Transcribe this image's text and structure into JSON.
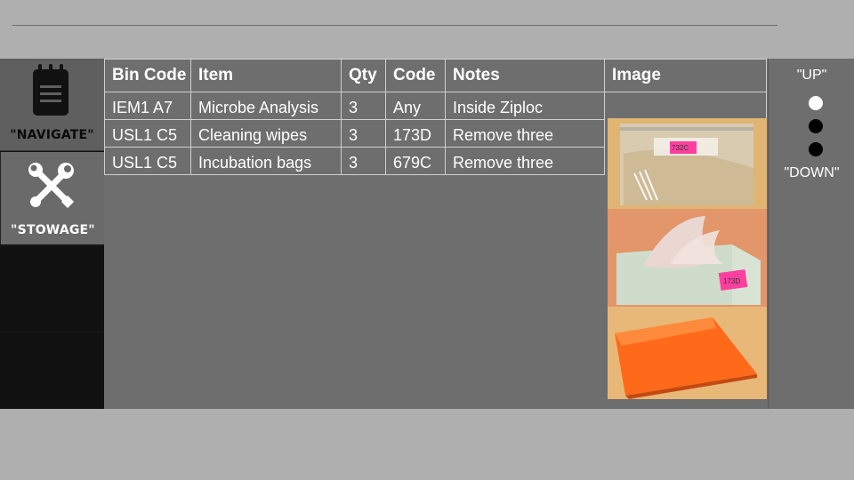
{
  "sidebar": {
    "navigate_label": "\"NAVIGATE\"",
    "stowage_label": "\"STOWAGE\""
  },
  "table": {
    "headers": [
      "Bin Code",
      "Item",
      "Qty",
      "Code",
      "Notes",
      "Image"
    ],
    "rows": [
      [
        "IEM1  A7",
        "Microbe Analysis",
        "3",
        "Any",
        "Inside Ziploc"
      ],
      [
        "USL1  C5",
        "Cleaning wipes",
        "3",
        "173D",
        "Remove three"
      ],
      [
        "USL1  C5",
        "Incubation bags",
        "3",
        "679C",
        "Remove three"
      ]
    ]
  },
  "images": {
    "ziploc_tag": "732C",
    "tissue_tag": "173D"
  },
  "scroll": {
    "up_label": "\"UP\"",
    "down_label": "\"DOWN\"",
    "active_dot": 1,
    "dot_count": 3
  },
  "colors": {
    "panel": "#6e6e6e",
    "background": "#afafaf",
    "sticky_note": "#ff3fa0",
    "incubation_bag": "#ff6a1a"
  }
}
